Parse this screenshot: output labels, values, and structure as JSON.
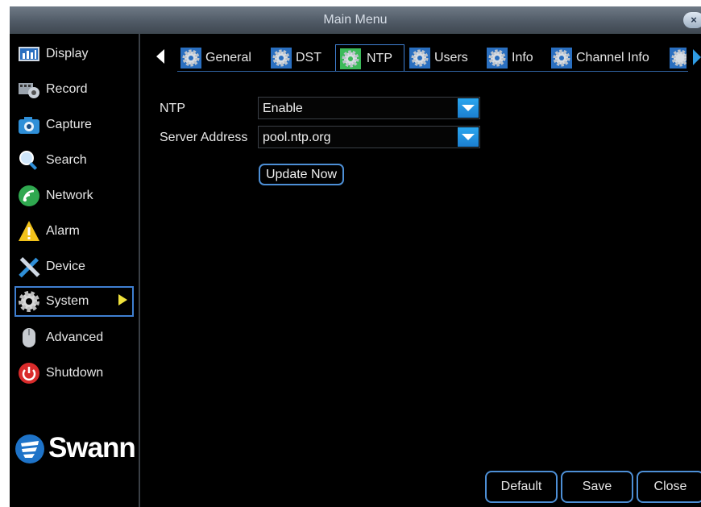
{
  "window": {
    "title": "Main Menu",
    "close_label": "×"
  },
  "sidebar": {
    "items": [
      {
        "label": "Display",
        "icon": "display-icon"
      },
      {
        "label": "Record",
        "icon": "record-icon"
      },
      {
        "label": "Capture",
        "icon": "camera-icon"
      },
      {
        "label": "Search",
        "icon": "search-icon"
      },
      {
        "label": "Network",
        "icon": "network-icon"
      },
      {
        "label": "Alarm",
        "icon": "alarm-icon"
      },
      {
        "label": "Device",
        "icon": "tools-icon"
      },
      {
        "label": "System",
        "icon": "gear-icon",
        "active": true
      },
      {
        "label": "Advanced",
        "icon": "mouse-icon"
      },
      {
        "label": "Shutdown",
        "icon": "power-icon"
      }
    ],
    "logo_text": "Swann"
  },
  "tabs": {
    "items": [
      {
        "label": "General"
      },
      {
        "label": "DST"
      },
      {
        "label": "NTP",
        "active": true
      },
      {
        "label": "Users"
      },
      {
        "label": "Info"
      },
      {
        "label": "Channel Info"
      }
    ]
  },
  "form": {
    "ntp_label": "NTP",
    "ntp_value": "Enable",
    "server_label": "Server Address",
    "server_value": "pool.ntp.org",
    "update_button": "Update Now"
  },
  "footer": {
    "default_label": "Default",
    "save_label": "Save",
    "close_label": "Close"
  },
  "colors": {
    "accent": "#3f7fd1",
    "dropdown": "#1c7fd0",
    "active_tab_icon": "#3cba5a",
    "arrow": "#f0e23c"
  }
}
